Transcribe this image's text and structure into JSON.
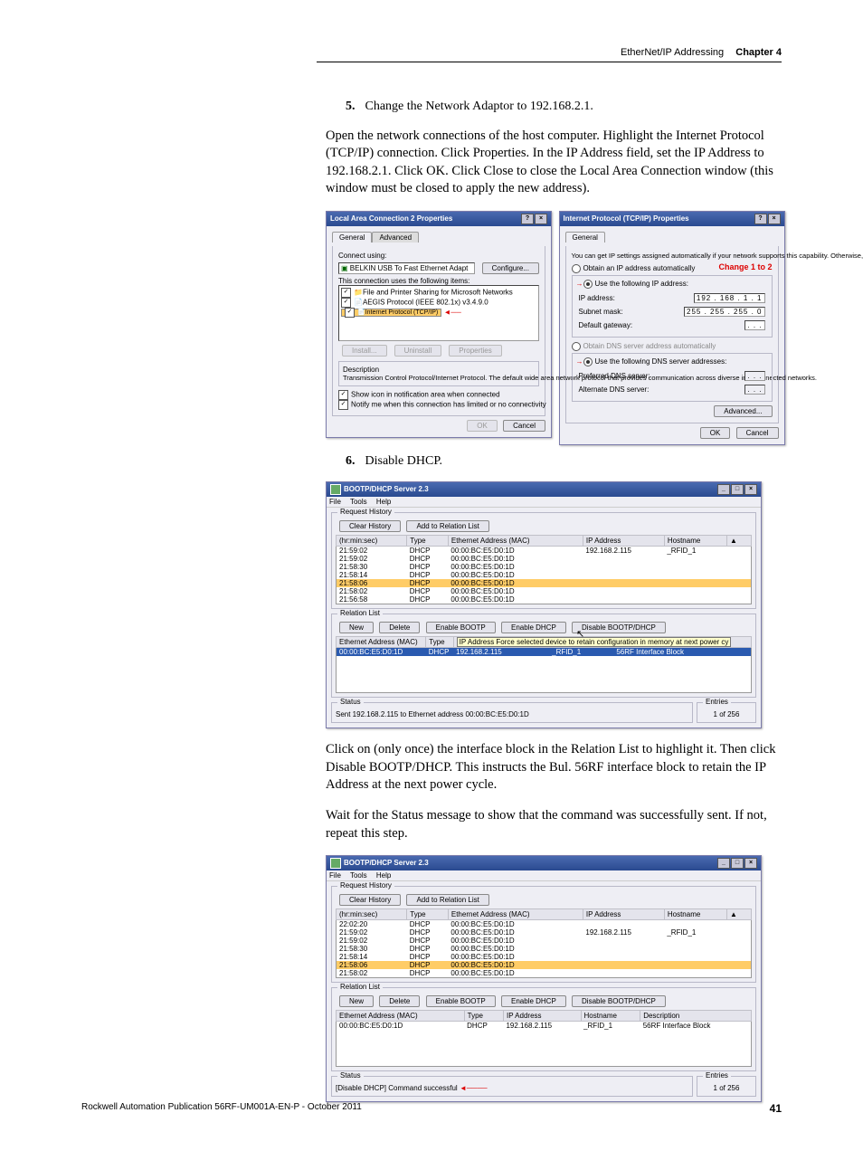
{
  "header": {
    "section": "EtherNet/IP Addressing",
    "chapter": "Chapter 4"
  },
  "steps": {
    "s5_num": "5.",
    "s5_text": "Change the Network Adaptor to 192.168.2.1.",
    "para1": "Open the network connections of the host computer. Highlight the Internet Protocol (TCP/IP) connection. Click Properties. In the IP Address field, set the IP Address to 192.168.2.1. Click OK. Click Close to close the Local Area Connection window (this window must be closed to apply the new address).",
    "s6_num": "6.",
    "s6_text": "Disable DHCP.",
    "para2": "Click on (only once) the interface block in the Relation List to highlight it. Then click Disable BOOTP/DHCP. This instructs the Bul. 56RF interface block to retain the IP Address at the next power cycle.",
    "para3": "Wait for the Status message to show that the command was successfully sent. If not, repeat this step."
  },
  "dlg1": {
    "title": "Local Area Connection 2 Properties",
    "tab1": "General",
    "tab2": "Advanced",
    "connect_using": "Connect using:",
    "adapter": "BELKIN USB To Fast Ethernet Adapt",
    "configure": "Configure...",
    "uses_items": "This connection uses the following items:",
    "it1": "File and Printer Sharing for Microsoft Networks",
    "it2": "AEGIS Protocol (IEEE 802.1x) v3.4.9.0",
    "it3": "Internet Protocol (TCP/IP)",
    "install": "Install...",
    "uninstall": "Uninstall",
    "properties": "Properties",
    "desc_h": "Description",
    "desc": "Transmission Control Protocol/Internet Protocol. The default wide area network protocol that provides communication across diverse interconnected networks.",
    "cb1": "Show icon in notification area when connected",
    "cb2": "Notify me when this connection has limited or no connectivity",
    "ok": "OK",
    "cancel": "Cancel"
  },
  "dlg2": {
    "title": "Internet Protocol (TCP/IP) Properties",
    "tab1": "General",
    "intro": "You can get IP settings assigned automatically if your network supports this capability. Otherwise, you need to ask your network administrator for the appropriate IP settings.",
    "r1": "Obtain an IP address automatically",
    "r2": "Use the following IP address:",
    "change": "Change 1 to 2",
    "ip_l": "IP address:",
    "ip_v": "192 . 168 .   1  .   1",
    "sm_l": "Subnet mask:",
    "sm_v": "255 . 255 . 255 .   0",
    "gw_l": "Default gateway:",
    "gw_v": " .      .      .  ",
    "r3": "Obtain DNS server address automatically",
    "r4": "Use the following DNS server addresses:",
    "pdns_l": "Preferred DNS server:",
    "pdns_v": " .      .      .  ",
    "adns_l": "Alternate DNS server:",
    "adns_v": " .      .      .  ",
    "adv": "Advanced...",
    "ok": "OK",
    "cancel": "Cancel"
  },
  "bootp": {
    "title": "BOOTP/DHCP Server 2.3",
    "m_file": "File",
    "m_tools": "Tools",
    "m_help": "Help",
    "gb_req": "Request History",
    "clear": "Clear History",
    "addrel": "Add to Relation List",
    "col_time": "(hr:min:sec)",
    "col_type": "Type",
    "col_mac": "Ethernet Address (MAC)",
    "col_ip": "IP Address",
    "col_host": "Hostname",
    "row_ip": "192.168.2.115",
    "row_host": "_RFID_1",
    "gb_rel": "Relation List",
    "new": "New",
    "del": "Delete",
    "ebootp": "Enable BOOTP",
    "edhcp": "Enable DHCP",
    "dboth": "Disable BOOTP/DHCP",
    "rcol_mac": "Ethernet Address (MAC)",
    "rcol_type": "Type",
    "rcol_ip": "IP Address",
    "rcol_host": "Hostname",
    "rcol_desc": "Description",
    "rcol_ip2": "IP Address Force selected device to retain configuration in memory at next power cy",
    "rrow_mac": "00:00:BC:E5:D0:1D",
    "rrow_type": "DHCP",
    "rrow_ip": "192.168.2.115",
    "rrow_host": "_RFID_1",
    "rrow_desc": "56RF Interface Block",
    "st_title": "Status",
    "ent_title": "Entries",
    "st1": "Sent 192.168.2.115 to Ethernet address 00:00:BC:E5:D0:1D",
    "st2": "[Disable DHCP] Command successful",
    "ent": "1 of 256"
  },
  "reqrows1": [
    {
      "t": "21:59:02",
      "ty": "DHCP",
      "m": "00:00:BC:E5:D0:1D",
      "ip": "192.168.2.115",
      "h": "_RFID_1"
    },
    {
      "t": "21:59:02",
      "ty": "DHCP",
      "m": "00:00:BC:E5:D0:1D",
      "ip": "",
      "h": ""
    },
    {
      "t": "21:58:30",
      "ty": "DHCP",
      "m": "00:00:BC:E5:D0:1D",
      "ip": "",
      "h": ""
    },
    {
      "t": "21:58:14",
      "ty": "DHCP",
      "m": "00:00:BC:E5:D0:1D",
      "ip": "",
      "h": ""
    },
    {
      "t": "21:58:06",
      "ty": "DHCP",
      "m": "00:00:BC:E5:D0:1D",
      "ip": "",
      "h": ""
    },
    {
      "t": "21:58:02",
      "ty": "DHCP",
      "m": "00:00:BC:E5:D0:1D",
      "ip": "",
      "h": ""
    },
    {
      "t": "21:56:58",
      "ty": "DHCP",
      "m": "00:00:BC:E5:D0:1D",
      "ip": "",
      "h": ""
    }
  ],
  "reqrows2": [
    {
      "t": "22:02:20",
      "ty": "DHCP",
      "m": "00:00:BC:E5:D0:1D",
      "ip": "",
      "h": ""
    },
    {
      "t": "21:59:02",
      "ty": "DHCP",
      "m": "00:00:BC:E5:D0:1D",
      "ip": "192.168.2.115",
      "h": "_RFID_1"
    },
    {
      "t": "21:59:02",
      "ty": "DHCP",
      "m": "00:00:BC:E5:D0:1D",
      "ip": "",
      "h": ""
    },
    {
      "t": "21:58:30",
      "ty": "DHCP",
      "m": "00:00:BC:E5:D0:1D",
      "ip": "",
      "h": ""
    },
    {
      "t": "21:58:14",
      "ty": "DHCP",
      "m": "00:00:BC:E5:D0:1D",
      "ip": "",
      "h": ""
    },
    {
      "t": "21:58:06",
      "ty": "DHCP",
      "m": "00:00:BC:E5:D0:1D",
      "ip": "",
      "h": ""
    },
    {
      "t": "21:58:02",
      "ty": "DHCP",
      "m": "00:00:BC:E5:D0:1D",
      "ip": "",
      "h": ""
    }
  ],
  "footer": {
    "pub": "Rockwell Automation Publication 56RF-UM001A-EN-P - October 2011",
    "page": "41"
  }
}
